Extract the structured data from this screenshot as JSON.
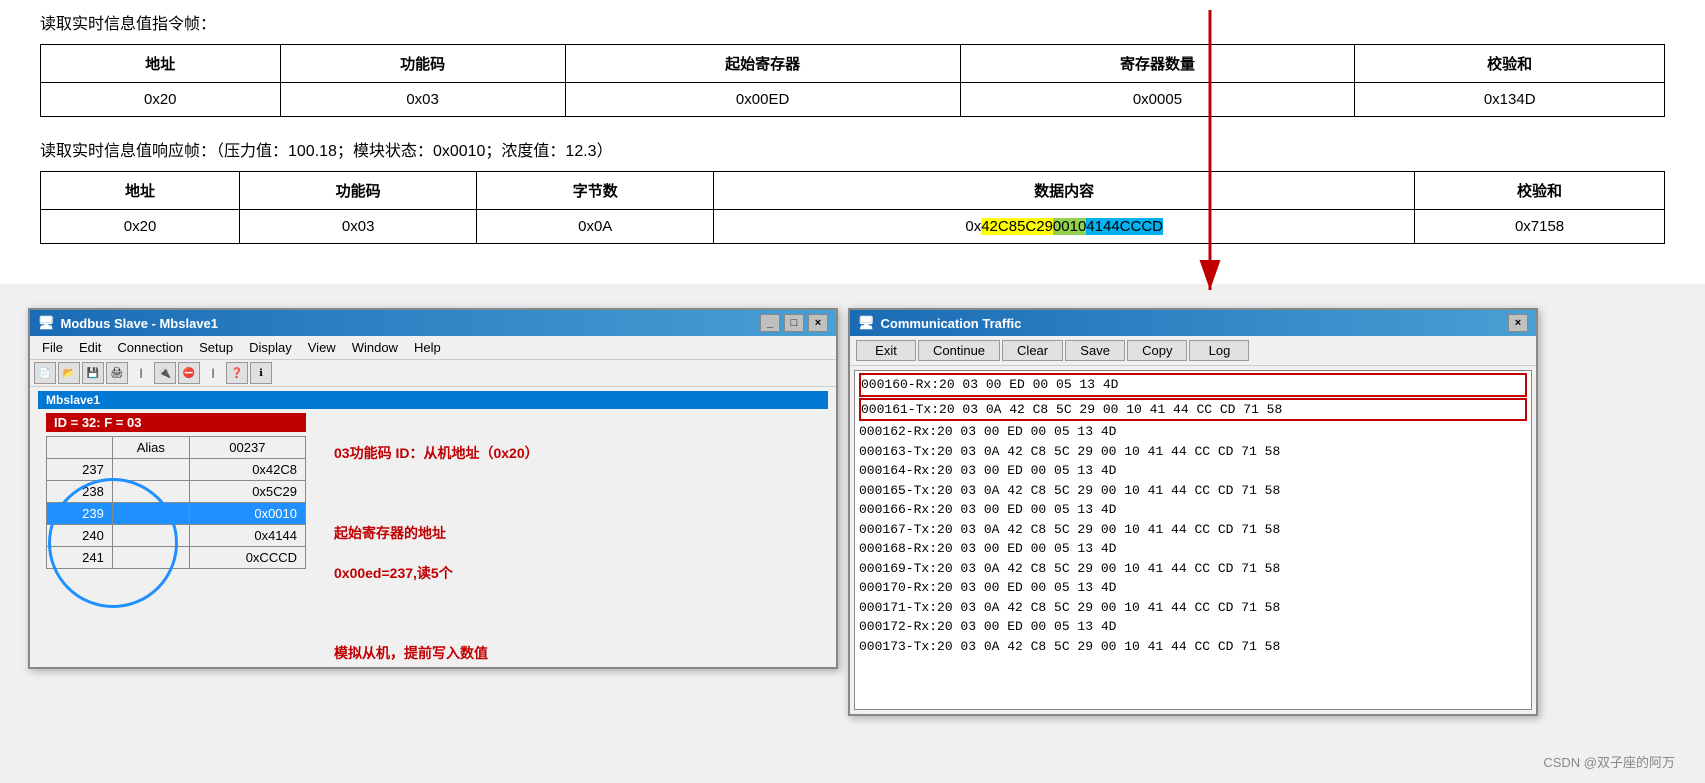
{
  "doc": {
    "intro_text": "读取实时信息值指令帧：",
    "table1": {
      "headers": [
        "地址",
        "功能码",
        "起始寄存器",
        "寄存器数量",
        "校验和"
      ],
      "rows": [
        [
          "0x20",
          "0x03",
          "0x00ED",
          "0x0005",
          "0x134D"
        ]
      ]
    },
    "response_text": "读取实时信息值响应帧：（压力值：100.18；模块状态：0x0010；浓度值：12.3）",
    "table2": {
      "headers": [
        "地址",
        "功能码",
        "字节数",
        "数据内容",
        "校验和"
      ],
      "rows": [
        [
          "0x20",
          "0x03",
          "0x0A",
          "0x42C85C2900104144CCCD",
          "0x7158"
        ]
      ]
    }
  },
  "modbus_window": {
    "title": "Modbus Slave - Mbslave1",
    "menu_items": [
      "File",
      "Edit",
      "Connection",
      "Setup",
      "Display",
      "View",
      "Window",
      "Help"
    ],
    "inner_title": "Mbslave1",
    "id_bar": "ID = 32: F = 03",
    "id_annotation": "03功能码  ID：从机地址（0x20）",
    "table": {
      "headers": [
        "",
        "Alias",
        "00237"
      ],
      "rows": [
        {
          "num": "237",
          "alias": "",
          "value": "0x42C8"
        },
        {
          "num": "238",
          "alias": "",
          "value": "0x5C29"
        },
        {
          "num": "239",
          "alias": "",
          "value": "0x0010",
          "highlighted": true
        },
        {
          "num": "240",
          "alias": "",
          "value": "0x4144"
        },
        {
          "num": "241",
          "alias": "",
          "value": "0xCCCD"
        }
      ]
    },
    "annotation1": "起始寄存器的地址",
    "annotation2": "0x00ed=237,读5个",
    "annotation3": "模拟从机，提前写入数值",
    "win_controls": [
      "_",
      "□",
      "×"
    ]
  },
  "comm_window": {
    "title": "Communication Traffic",
    "buttons": [
      "Exit",
      "Continue",
      "Clear",
      "Save",
      "Copy",
      "Log"
    ],
    "log_lines": [
      {
        "id": "000160",
        "type": "Rx",
        "data": "20 03 00 ED 00 05 13 4D",
        "highlighted": true
      },
      {
        "id": "000161",
        "type": "Tx",
        "data": "20 03 0A 42 C8 5C 29 00 10 41 44 CC CD 71 58",
        "highlighted": true
      },
      {
        "id": "000162",
        "type": "Rx",
        "data": "20 03 00 ED 00 05 13 4D"
      },
      {
        "id": "000163",
        "type": "Tx",
        "data": "20 03 0A 42 C8 5C 29 00 10 41 44 CC CD 71 58"
      },
      {
        "id": "000164",
        "type": "Rx",
        "data": "20 03 00 ED 00 05 13 4D"
      },
      {
        "id": "000165",
        "type": "Tx",
        "data": "20 03 0A 42 C8 5C 29 00 10 41 44 CC CD 71 58"
      },
      {
        "id": "000166",
        "type": "Rx",
        "data": "20 03 00 ED 00 05 13 4D"
      },
      {
        "id": "000167",
        "type": "Tx",
        "data": "20 03 0A 42 C8 5C 29 00 10 41 44 CC CD 71 58"
      },
      {
        "id": "000168",
        "type": "Rx",
        "data": "20 03 00 ED 00 05 13 4D"
      },
      {
        "id": "000169",
        "type": "Tx",
        "data": "20 03 0A 42 C8 5C 29 00 10 41 44 CC CD 71 58"
      },
      {
        "id": "000170",
        "type": "Rx",
        "data": "20 03 00 ED 00 05 13 4D"
      },
      {
        "id": "000171",
        "type": "Tx",
        "data": "20 03 0A 42 C8 5C 29 00 10 41 44 CC CD 71 58"
      },
      {
        "id": "000172",
        "type": "Rx",
        "data": "20 03 00 ED 00 05 13 4D"
      },
      {
        "id": "000173",
        "type": "Tx",
        "data": "20 03 0A 42 C8 5C 29 00 10 41 44 CC CD 71 58"
      }
    ],
    "win_controls": [
      "×"
    ]
  },
  "watermark": "CSDN @双子座的阿万"
}
